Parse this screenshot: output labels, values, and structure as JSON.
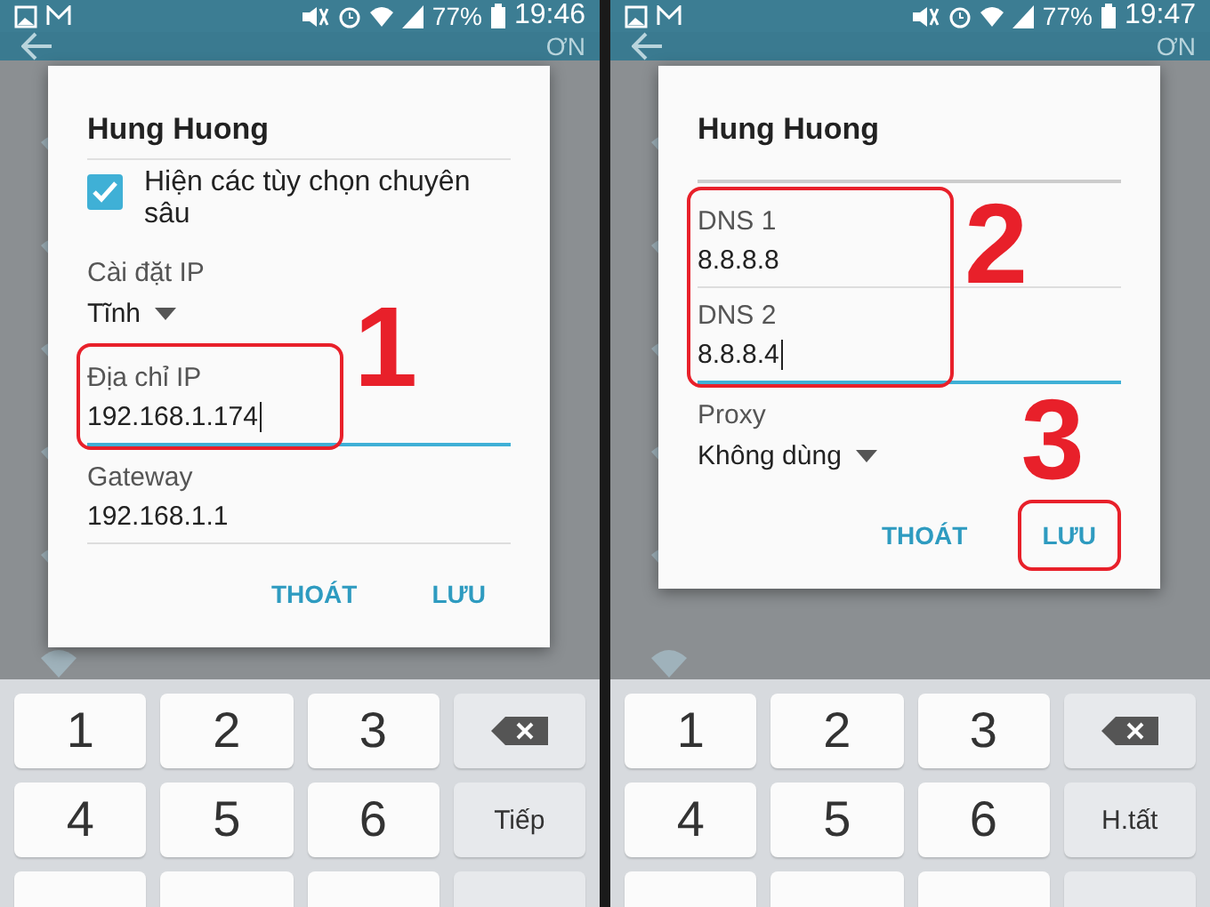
{
  "phones": [
    {
      "status": {
        "time": "19:46",
        "battery": "77%"
      },
      "appbar_text": "ƠN",
      "dialog": {
        "title": "Hung Huong",
        "items": [
          {
            "kind": "checkbox",
            "label": "Hiện các tùy chọn chuyên sâu",
            "checked": true
          },
          {
            "kind": "dropdown",
            "label": "Cài đặt IP",
            "value": "Tĩnh"
          },
          {
            "kind": "group",
            "highlighted": true,
            "callout": "1",
            "children": [
              {
                "kind": "input",
                "label": "Địa chỉ IP",
                "value": "192.168.1.174",
                "focused": true
              }
            ]
          },
          {
            "kind": "input",
            "label": "Gateway",
            "value": "192.168.1.1",
            "focused": false
          }
        ],
        "buttons": [
          {
            "label": "THOÁT",
            "highlighted": false
          },
          {
            "label": "LƯU",
            "highlighted": false
          }
        ]
      },
      "keyboard": {
        "keys": [
          {
            "kind": "digit",
            "label": "1"
          },
          {
            "kind": "digit",
            "label": "2"
          },
          {
            "kind": "digit",
            "label": "3"
          },
          {
            "kind": "backspace"
          },
          {
            "kind": "digit",
            "label": "4"
          },
          {
            "kind": "digit",
            "label": "5"
          },
          {
            "kind": "digit",
            "label": "6"
          },
          {
            "kind": "action",
            "label": "Tiếp"
          }
        ]
      }
    },
    {
      "status": {
        "time": "19:47",
        "battery": "77%"
      },
      "appbar_text": "ƠN",
      "dialog": {
        "title": "Hung Huong",
        "items": [
          {
            "kind": "cutoff"
          },
          {
            "kind": "group",
            "highlighted": true,
            "callout": "2",
            "children": [
              {
                "kind": "input",
                "label": "DNS 1",
                "value": "8.8.8.8",
                "focused": false
              },
              {
                "kind": "input",
                "label": "DNS 2",
                "value": "8.8.8.4",
                "focused": true
              }
            ]
          },
          {
            "kind": "dropdown",
            "label": "Proxy",
            "value": "Không dùng"
          }
        ],
        "buttons": [
          {
            "label": "THOÁT",
            "highlighted": false
          },
          {
            "label": "LƯU",
            "highlighted": true,
            "callout": "3"
          }
        ]
      },
      "keyboard": {
        "keys": [
          {
            "kind": "digit",
            "label": "1"
          },
          {
            "kind": "digit",
            "label": "2"
          },
          {
            "kind": "digit",
            "label": "3"
          },
          {
            "kind": "backspace"
          },
          {
            "kind": "digit",
            "label": "4"
          },
          {
            "kind": "digit",
            "label": "5"
          },
          {
            "kind": "digit",
            "label": "6"
          },
          {
            "kind": "action",
            "label": "H.tất"
          }
        ]
      }
    }
  ]
}
